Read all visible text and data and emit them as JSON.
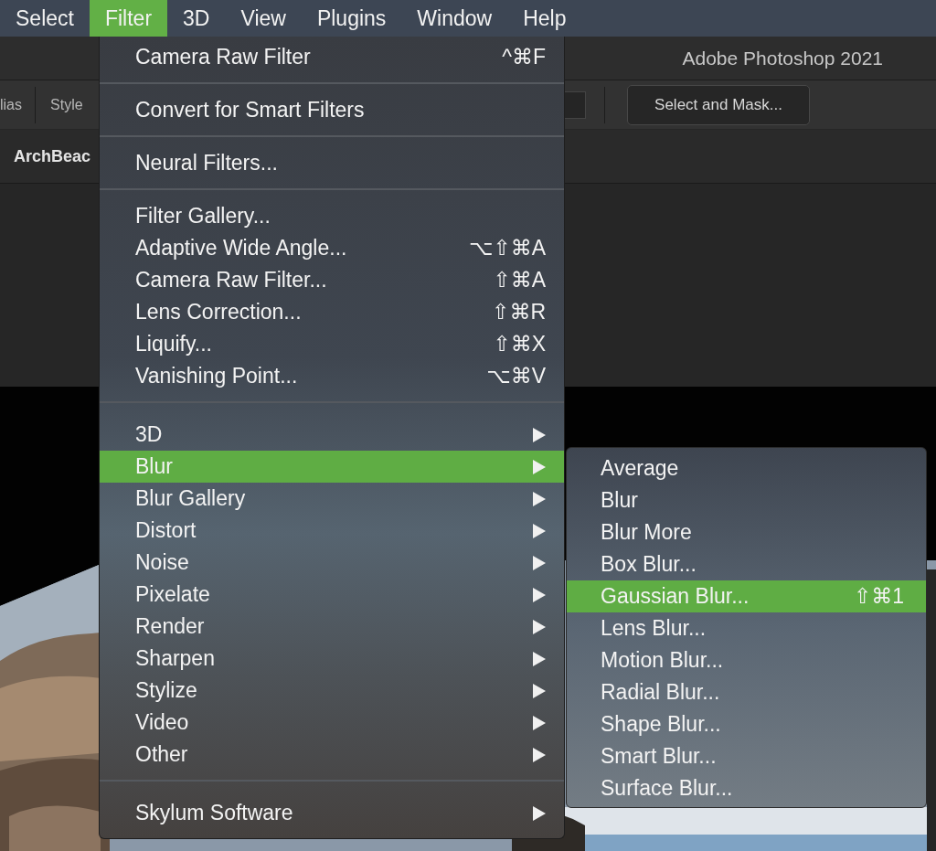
{
  "menu_bar": [
    {
      "label": "Select",
      "selected": false
    },
    {
      "label": "Filter",
      "selected": true
    },
    {
      "label": "3D",
      "selected": false
    },
    {
      "label": "View",
      "selected": false
    },
    {
      "label": "Plugins",
      "selected": false
    },
    {
      "label": "Window",
      "selected": false
    },
    {
      "label": "Help",
      "selected": false
    }
  ],
  "window": {
    "title": "Adobe Photoshop 2021"
  },
  "options_bar": {
    "antialias_label": "lias",
    "style_label": "Style",
    "select_and_mask_button": "Select and Mask..."
  },
  "document_tab": {
    "label": "ArchBeac"
  },
  "filter_menu": {
    "sections": [
      [
        {
          "label": "Camera Raw Filter",
          "shortcut": "^⌘F",
          "submenu": false,
          "selected": false
        }
      ],
      [
        {
          "label": "Convert for Smart Filters",
          "submenu": false,
          "selected": false
        }
      ],
      [
        {
          "label": "Neural Filters...",
          "submenu": false,
          "selected": false
        }
      ],
      [
        {
          "label": "Filter Gallery...",
          "submenu": false,
          "selected": false
        },
        {
          "label": "Adaptive Wide Angle...",
          "shortcut": "⌥⇧⌘A",
          "submenu": false,
          "selected": false
        },
        {
          "label": "Camera Raw Filter...",
          "shortcut": "⇧⌘A",
          "submenu": false,
          "selected": false
        },
        {
          "label": "Lens Correction...",
          "shortcut": "⇧⌘R",
          "submenu": false,
          "selected": false
        },
        {
          "label": "Liquify...",
          "shortcut": "⇧⌘X",
          "submenu": false,
          "selected": false
        },
        {
          "label": "Vanishing Point...",
          "shortcut": "⌥⌘V",
          "submenu": false,
          "selected": false
        }
      ],
      [
        {
          "label": "3D",
          "submenu": true,
          "selected": false
        },
        {
          "label": "Blur",
          "submenu": true,
          "selected": true
        },
        {
          "label": "Blur Gallery",
          "submenu": true,
          "selected": false
        },
        {
          "label": "Distort",
          "submenu": true,
          "selected": false
        },
        {
          "label": "Noise",
          "submenu": true,
          "selected": false
        },
        {
          "label": "Pixelate",
          "submenu": true,
          "selected": false
        },
        {
          "label": "Render",
          "submenu": true,
          "selected": false
        },
        {
          "label": "Sharpen",
          "submenu": true,
          "selected": false
        },
        {
          "label": "Stylize",
          "submenu": true,
          "selected": false
        },
        {
          "label": "Video",
          "submenu": true,
          "selected": false
        },
        {
          "label": "Other",
          "submenu": true,
          "selected": false
        }
      ],
      [
        {
          "label": "Skylum Software",
          "submenu": true,
          "selected": false
        }
      ]
    ]
  },
  "blur_submenu": {
    "items": [
      {
        "label": "Average",
        "selected": false
      },
      {
        "label": "Blur",
        "selected": false
      },
      {
        "label": "Blur More",
        "selected": false
      },
      {
        "label": "Box Blur...",
        "selected": false
      },
      {
        "label": "Gaussian Blur...",
        "shortcut": "⇧⌘1",
        "selected": true
      },
      {
        "label": "Lens Blur...",
        "selected": false
      },
      {
        "label": "Motion Blur...",
        "selected": false
      },
      {
        "label": "Radial Blur...",
        "selected": false
      },
      {
        "label": "Shape Blur...",
        "selected": false
      },
      {
        "label": "Smart Blur...",
        "selected": false
      },
      {
        "label": "Surface Blur...",
        "selected": false
      }
    ]
  }
}
